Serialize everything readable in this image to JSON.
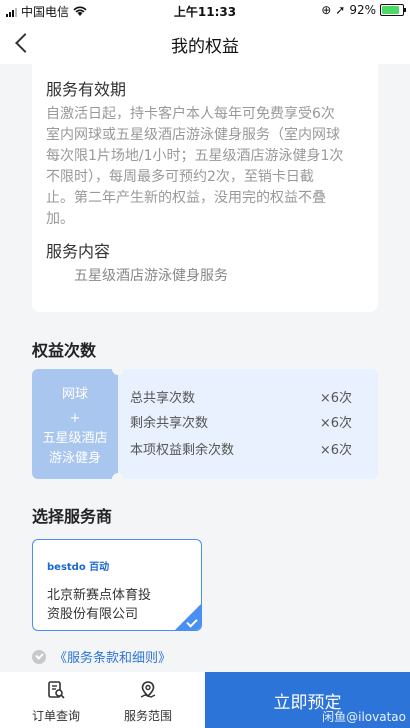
{
  "status_bar": {
    "carrier": "中国电信",
    "time": "上午11:33",
    "battery_pct": "92%",
    "battery_level": 0.92
  },
  "nav": {
    "title": "我的权益"
  },
  "validity": {
    "title": "服务有效期",
    "text_lines": [
      "自激活日起，持卡客户本人每年可免费享受6次",
      "室内网球或五星级酒店游泳健身服务（室内网球",
      "每次限1片场地/1小时；五星级酒店游泳健身1次",
      "不限时），每周最多可预约2次，至销卡日截",
      "止。第二年产生新的权益，没用完的权益不叠",
      "加。"
    ]
  },
  "content": {
    "title": "服务内容",
    "item": "五星级酒店游泳健身服务"
  },
  "quota": {
    "section_title": "权益次数",
    "left_lines": [
      "网球",
      "+",
      "五星级酒店",
      "游泳健身"
    ],
    "rows": [
      {
        "label": "总共享次数",
        "value": "×6次"
      },
      {
        "label": "剩余共享次数",
        "value": "×6次"
      },
      {
        "label": "本项权益剩余次数",
        "value": "×6次"
      }
    ]
  },
  "provider": {
    "section_title": "选择服务商",
    "logo_text": "bestdo 百动",
    "name_lines": [
      "北京新赛点体育投",
      "资股份有限公司"
    ]
  },
  "terms": {
    "label": "《服务条款和细则》"
  },
  "footer": {
    "tab1": "订单查询",
    "tab2": "服务范围",
    "book_button": "立即预定",
    "watermark": "闲鱼@ilovatao"
  },
  "colors": {
    "accent": "#2c74d8",
    "quota_bg": "#e8f1fd",
    "quota_left": "#a9c6ee"
  }
}
